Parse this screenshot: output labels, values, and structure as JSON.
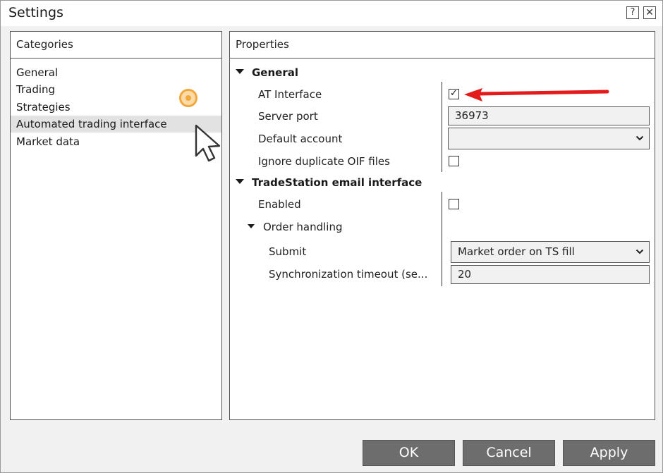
{
  "window": {
    "title": "Settings",
    "help_icon": "?",
    "close_icon": "✕"
  },
  "categories": {
    "header": "Categories",
    "items": [
      {
        "label": "General"
      },
      {
        "label": "Trading"
      },
      {
        "label": "Strategies"
      },
      {
        "label": "Automated trading interface",
        "selected": true
      },
      {
        "label": "Market data"
      }
    ]
  },
  "properties": {
    "header": "Properties",
    "general": {
      "title": "General",
      "at_interface": {
        "label": "AT Interface",
        "checked": true,
        "check_glyph": "✓"
      },
      "server_port": {
        "label": "Server port",
        "value": "36973"
      },
      "default_account": {
        "label": "Default account",
        "value": ""
      },
      "ignore_oif": {
        "label": "Ignore duplicate OIF files",
        "checked": false
      }
    },
    "tradestation": {
      "title": "TradeStation email interface",
      "enabled": {
        "label": "Enabled",
        "checked": false
      },
      "order_handling": {
        "title": "Order handling",
        "submit": {
          "label": "Submit",
          "value": "Market order on TS fill"
        },
        "sync_timeout": {
          "label": "Synchronization timeout (se...",
          "value": "20"
        }
      }
    }
  },
  "buttons": {
    "ok": "OK",
    "cancel": "Cancel",
    "apply": "Apply"
  },
  "icons": {
    "dropdown_chevron": "⌄"
  },
  "colors": {
    "annotation_arrow": "#e31b1b",
    "cursor_highlight": "#f2a73c",
    "button_bg": "#6d6d6d",
    "selected_row": "#e2e2e2"
  }
}
